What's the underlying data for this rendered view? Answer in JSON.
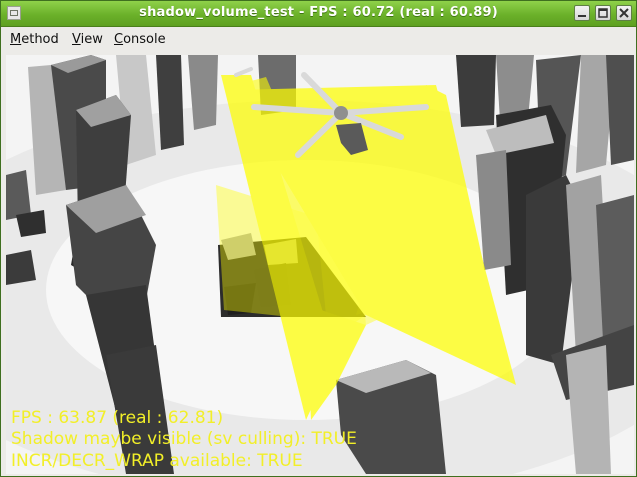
{
  "window": {
    "title": "shadow_volume_test - FPS : 60.72 (real : 60.89)"
  },
  "menubar": {
    "items": [
      {
        "mnemonic": "M",
        "rest": "ethod"
      },
      {
        "mnemonic": "V",
        "rest": "iew"
      },
      {
        "mnemonic": "C",
        "rest": "onsole"
      }
    ]
  },
  "hud": {
    "fps_line": "FPS : 63.87 (real : 62.81)",
    "shadow_line": "Shadow maybe visible (sv culling): TRUE",
    "wrap_line": "INCR/DECR_WRAP available: TRUE"
  },
  "colors": {
    "titlebar": "#6bb12a",
    "hud_text": "#f2ef28",
    "shadow_volume": "#ffff00",
    "pillar": "#a8a8a8",
    "floor": "#ececec"
  },
  "icons": {
    "app": "app-window-icon",
    "minimize": "minimize-icon",
    "maximize": "maximize-icon",
    "close": "close-icon"
  }
}
